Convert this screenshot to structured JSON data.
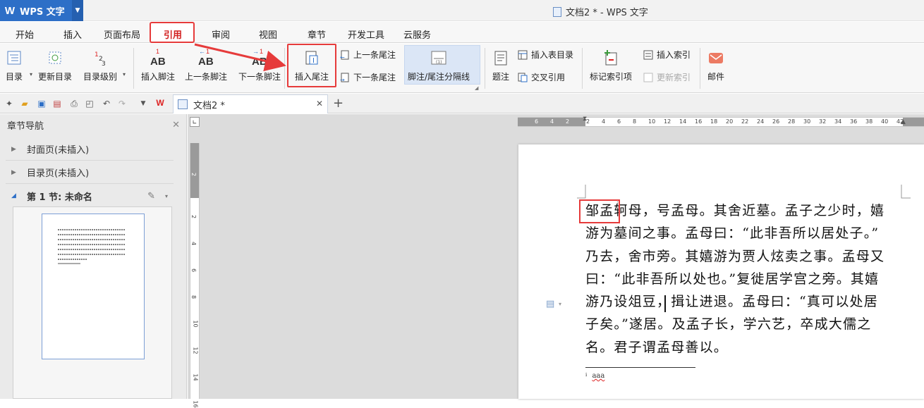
{
  "app": {
    "name": "WPS 文字",
    "window_title": "文档2 * - WPS 文字"
  },
  "menu": {
    "tabs": [
      {
        "label": "开始"
      },
      {
        "label": "插入"
      },
      {
        "label": "页面布局"
      },
      {
        "label": "引用"
      },
      {
        "label": "审阅"
      },
      {
        "label": "视图"
      },
      {
        "label": "章节"
      },
      {
        "label": "开发工具"
      },
      {
        "label": "云服务"
      }
    ],
    "active_tab": "引用"
  },
  "ribbon": {
    "toc": "目录",
    "update_toc": "更新目录",
    "toc_level": "目录级别",
    "insert_footnote": "插入脚注",
    "prev_footnote": "上一条脚注",
    "next_footnote": "下一条脚注",
    "insert_endnote": "插入尾注",
    "prev_endnote": "上一条尾注",
    "next_endnote": "下一条尾注",
    "separator": "脚注/尾注分隔线",
    "caption": "题注",
    "insert_table_toc": "插入表目录",
    "cross_ref": "交叉引用",
    "mark_index": "标记索引项",
    "insert_index": "插入索引",
    "update_index": "更新索引",
    "mail": "邮件"
  },
  "doc_tab": {
    "title": "文档2 *"
  },
  "nav": {
    "title": "章节导航",
    "cover": "封面页(未插入)",
    "toc": "目录页(未插入)",
    "section": "第 1 节: 未命名"
  },
  "document": {
    "lines": [
      "邹孟轲母，号孟母。其舍近墓。孟子之少时，嬉",
      "游为墓间之事。孟母曰：“此非吾所以居处子。”",
      "乃去，舍市旁。其嬉游为贾人炫卖之事。孟母又",
      "曰：“此非吾所以处也。”复徙居学宫之旁。其嬉",
      "游乃设俎豆，揖让进退。孟母曰：“真可以处居",
      "子矣。”遂居。及孟子长，学六艺，卒成大儒之",
      "名。君子谓孟母善以。"
    ],
    "endnote_text": "aaa",
    "endnote_mark": "i"
  },
  "rulers": {
    "h_ticks": [
      "6",
      "4",
      "2",
      "2",
      "4",
      "6",
      "8",
      "10",
      "12",
      "14",
      "16",
      "18",
      "20",
      "22",
      "24",
      "26",
      "28",
      "30",
      "32",
      "34",
      "36",
      "38",
      "40",
      "42"
    ],
    "v_ticks": [
      "2",
      "2",
      "4",
      "6",
      "8",
      "10",
      "12",
      "14",
      "16"
    ]
  },
  "colors": {
    "highlight": "#e63b3b",
    "accent": "#2d6fc7"
  }
}
